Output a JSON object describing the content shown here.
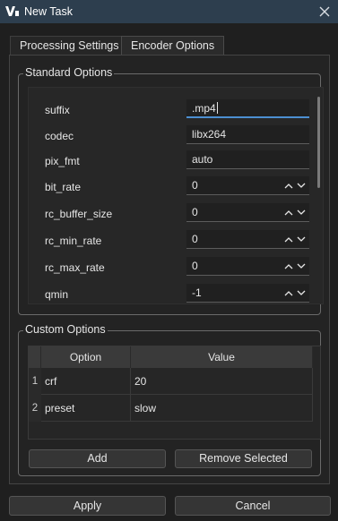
{
  "window": {
    "title": "New Task",
    "icon": "app-logo-icon",
    "close_icon": "close-icon"
  },
  "tabs": [
    {
      "label": "Processing Settings",
      "active": false
    },
    {
      "label": "Encoder Options",
      "active": true
    }
  ],
  "standard_options": {
    "title": "Standard Options",
    "items": [
      {
        "label": "suffix",
        "value": ".mp4",
        "kind": "text",
        "focused": true
      },
      {
        "label": "codec",
        "value": "libx264",
        "kind": "text"
      },
      {
        "label": "pix_fmt",
        "value": "auto",
        "kind": "text"
      },
      {
        "label": "bit_rate",
        "value": "0",
        "kind": "spin"
      },
      {
        "label": "rc_buffer_size",
        "value": "0",
        "kind": "spin"
      },
      {
        "label": "rc_min_rate",
        "value": "0",
        "kind": "spin"
      },
      {
        "label": "rc_max_rate",
        "value": "0",
        "kind": "spin"
      },
      {
        "label": "qmin",
        "value": "-1",
        "kind": "spin"
      }
    ]
  },
  "custom_options": {
    "title": "Custom Options",
    "columns": [
      "Option",
      "Value"
    ],
    "rows": [
      {
        "num": "1",
        "option": "crf",
        "value": "20"
      },
      {
        "num": "2",
        "option": "preset",
        "value": "slow"
      }
    ],
    "add_label": "Add",
    "remove_label": "Remove Selected"
  },
  "footer": {
    "apply_label": "Apply",
    "cancel_label": "Cancel"
  },
  "colors": {
    "titlebar": "#2d3e4e",
    "accent": "#4c8fd1",
    "background": "#1f1f1f"
  }
}
